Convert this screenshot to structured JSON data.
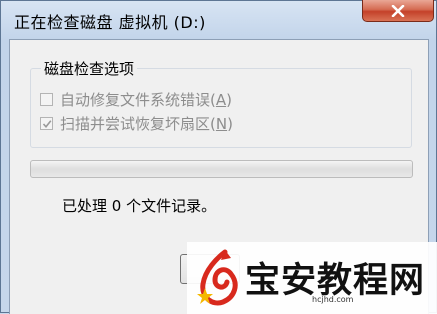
{
  "window": {
    "title": "正在检查磁盘 虚拟机 (D:)"
  },
  "group": {
    "legend": "磁盘检查选项",
    "options": [
      {
        "label": "自动修复文件系统错误",
        "accel_open": "(",
        "accel_key": "A",
        "accel_close": ")",
        "checked": false,
        "enabled": false
      },
      {
        "label": "扫描并尝试恢复坏扇区",
        "accel_open": "(",
        "accel_key": "N",
        "accel_close": ")",
        "checked": true,
        "enabled": false
      }
    ]
  },
  "progress": {
    "value": 0
  },
  "status": {
    "text": "已处理  0 个文件记录。"
  },
  "watermark": {
    "brand": "宝安教程网",
    "url": "hcjhd.com"
  },
  "colors": {
    "progress_fill": "#06b025",
    "close_button": "#c44129"
  }
}
